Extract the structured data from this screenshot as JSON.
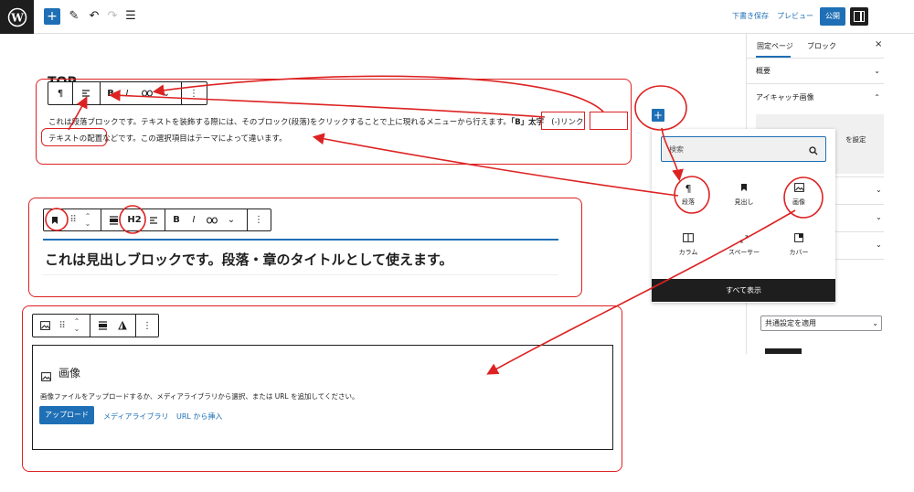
{
  "topbar": {
    "draft_save": "下書き保存",
    "preview": "プレビュー",
    "publish": "公開"
  },
  "sidebar": {
    "tab_page": "固定ページ",
    "tab_block": "ブロック",
    "close": "×",
    "summary": "概要",
    "featured_image": "アイキャッチ画像",
    "featured_hint": "を設定",
    "select_value": "共通設定を適用"
  },
  "paragraph_block": {
    "heading_partial": "TOP",
    "line1": "これは段落ブロックです。テキストを装飾する際には、そのブロック(段落)をクリックすることで上に現れるメニューから行えます。",
    "bold_label": "「B」太字",
    "link_label": "(-)リンク",
    "line2a": "テキストの配置",
    "line2b": "などです。この選択項目はテーマによって違います。"
  },
  "toolbar1": {
    "para": "¶",
    "bold": "B",
    "italic": "I",
    "more": "⋮"
  },
  "heading_block": {
    "h2_label": "H2",
    "text": "これは見出しブロックです。段落・章のタイトルとして使えます。"
  },
  "inserter": {
    "search_placeholder": "検索",
    "items": [
      {
        "label": "段落",
        "icon": "paragraph-icon"
      },
      {
        "label": "見出し",
        "icon": "bookmark-icon"
      },
      {
        "label": "画像",
        "icon": "image-icon"
      },
      {
        "label": "カラム",
        "icon": "columns-icon"
      },
      {
        "label": "スペーサー",
        "icon": "spacer-icon"
      },
      {
        "label": "カバー",
        "icon": "cover-icon"
      }
    ],
    "show_all": "すべて表示"
  },
  "image_block": {
    "title": "画像",
    "description": "画像ファイルをアップロードするか、メディアライブラリから選択、または URL を追加してください。",
    "upload": "アップロード",
    "media_library": "メディアライブラリ",
    "insert_url": "URL から挿入"
  },
  "colors": {
    "accent": "#1e6fb5",
    "annotation": "#dd2222",
    "dark": "#1e1e1e"
  }
}
